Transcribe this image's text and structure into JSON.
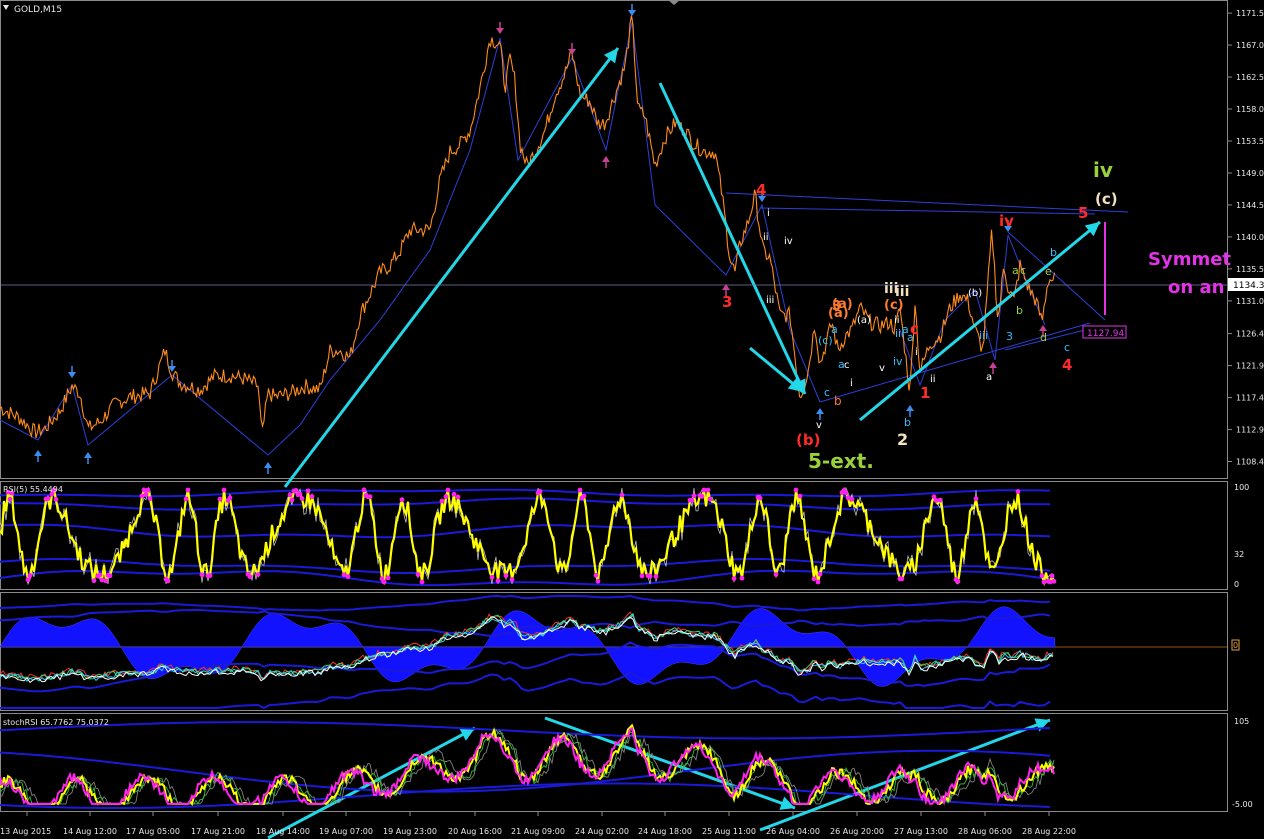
{
  "chart_data": {
    "type": "line",
    "title": "GOLD,M15",
    "symbol": "GOLD",
    "timeframe": "M15",
    "price_axis": {
      "ticks": [
        "1171.5",
        "1167.0",
        "1162.5",
        "1158.0",
        "1153.5",
        "1149.0",
        "1144.5",
        "1140.0",
        "1135.5",
        "1131.0",
        "1126.4",
        "1121.9",
        "1117.4",
        "1112.9",
        "1108.4"
      ],
      "ylim": [
        1106.5,
        1172.5
      ],
      "current_price": "1134.3",
      "current_price_value": 1134.3,
      "target_label": "1127.94",
      "target_value": 1127.94
    },
    "time_axis": {
      "labels": [
        "13 Aug 2015",
        "14 Aug 12:00",
        "17 Aug 05:00",
        "17 Aug 21:00",
        "18 Aug 14:00",
        "19 Aug 07:00",
        "19 Aug 23:00",
        "20 Aug 16:00",
        "21 Aug 09:00",
        "24 Aug 02:00",
        "24 Aug 18:00",
        "25 Aug 11:00",
        "26 Aug 04:00",
        "26 Aug 20:00",
        "27 Aug 13:00",
        "28 Aug 06:00",
        "28 Aug 22:00"
      ]
    },
    "price_series": {
      "name": "",
      "x": [
        0,
        20,
        35,
        45,
        60,
        72,
        80,
        88,
        100,
        115,
        130,
        150,
        165,
        172,
        180,
        200,
        215,
        230,
        245,
        258,
        262,
        268,
        275,
        290,
        305,
        320,
        330,
        340,
        350,
        360,
        370,
        380,
        390,
        400,
        410,
        420,
        430,
        440,
        450,
        460,
        470,
        480,
        490,
        500,
        505,
        510,
        515,
        520,
        527,
        535,
        545,
        555,
        565,
        572,
        580,
        590,
        598,
        605,
        615,
        625,
        632,
        638,
        645,
        655,
        665,
        675,
        685,
        695,
        705,
        715,
        722,
        730,
        735,
        740,
        748,
        755,
        763,
        770,
        780,
        790,
        800,
        808,
        815,
        820,
        826,
        832,
        838,
        845,
        852,
        860,
        870,
        880,
        890,
        895,
        900,
        905,
        910,
        915,
        920,
        930,
        940,
        950,
        960,
        968,
        975,
        983,
        992,
        998,
        1004,
        1008,
        1014,
        1020,
        1028,
        1036,
        1042,
        1048,
        1055
      ],
      "y": [
        1116,
        1114.5,
        1112.5,
        1113,
        1115.5,
        1119,
        1118,
        1113,
        1114,
        1116.5,
        1117.5,
        1118,
        1124,
        1121,
        1119.5,
        1118.5,
        1120.5,
        1120.5,
        1120,
        1119,
        1112,
        1118,
        1117.5,
        1118,
        1119,
        1118.5,
        1124,
        1124,
        1123,
        1129,
        1132,
        1135,
        1136,
        1138,
        1141,
        1141,
        1141,
        1148,
        1152,
        1153,
        1155,
        1161,
        1168,
        1167,
        1161,
        1165,
        1162,
        1153,
        1150,
        1152,
        1155,
        1160,
        1163,
        1166,
        1160,
        1159,
        1156,
        1156,
        1160,
        1164,
        1171,
        1158,
        1157,
        1150,
        1154,
        1156,
        1155,
        1153,
        1152,
        1152,
        1146,
        1137,
        1135,
        1139,
        1142,
        1146,
        1138,
        1137,
        1129,
        1129,
        1117.5,
        1121,
        1128,
        1122,
        1125,
        1128,
        1124,
        1126,
        1127,
        1130,
        1128,
        1127.5,
        1128,
        1127,
        1130,
        1124,
        1118,
        1131,
        1121,
        1125,
        1126,
        1130,
        1132,
        1131,
        1127,
        1124,
        1141,
        1128,
        1136,
        1133,
        1131,
        1136,
        1133,
        1131,
        1128,
        1134,
        1134
      ]
    },
    "annotations": [
      "4",
      "3",
      "i",
      "ii",
      "iii",
      "iv",
      "v",
      "3",
      "(a)",
      "(c)",
      "a",
      "c",
      "b",
      "(b)",
      "5-ext.",
      "iii",
      "(a)",
      "iii",
      "a",
      "b",
      "c",
      "i",
      "ii",
      "v",
      "iv",
      "a",
      "c",
      "1",
      "2",
      "(b)",
      "iii",
      "a",
      "iv",
      "3",
      "a",
      "c",
      "b",
      "e",
      "d",
      "c",
      "4",
      "b",
      "5",
      "(c)",
      "iv"
    ],
    "side_text": [
      "Symmet",
      "on an"
    ],
    "rsi": {
      "label": "RSI(5) 55.4494",
      "levels": [
        "100",
        "32",
        "0"
      ],
      "ylim": [
        0,
        100
      ]
    },
    "macd": {
      "label": "",
      "zero_marker": "0"
    },
    "stochrsi": {
      "label": "stochRSI 65.7762 75.0372",
      "levels": [
        "105",
        "-5.00"
      ],
      "ylim": [
        -5,
        105
      ]
    },
    "colors": {
      "background": "#000000",
      "price": "#ff8c1a",
      "wave_lines": "#2e3fd8",
      "trend_arrows": "#24d7e8",
      "rsi": "#ffff00",
      "rsi_dots": "#ff22ee",
      "bands": "#1a1ad8",
      "macd_hist": "#1212ff",
      "red_label": "#ff2a2a",
      "cyan_label": "#33bfff",
      "green_label": "#9ad03a",
      "orange_label": "#ff7a30",
      "white_label": "#ffffff",
      "magenta": "#e233e6"
    }
  }
}
